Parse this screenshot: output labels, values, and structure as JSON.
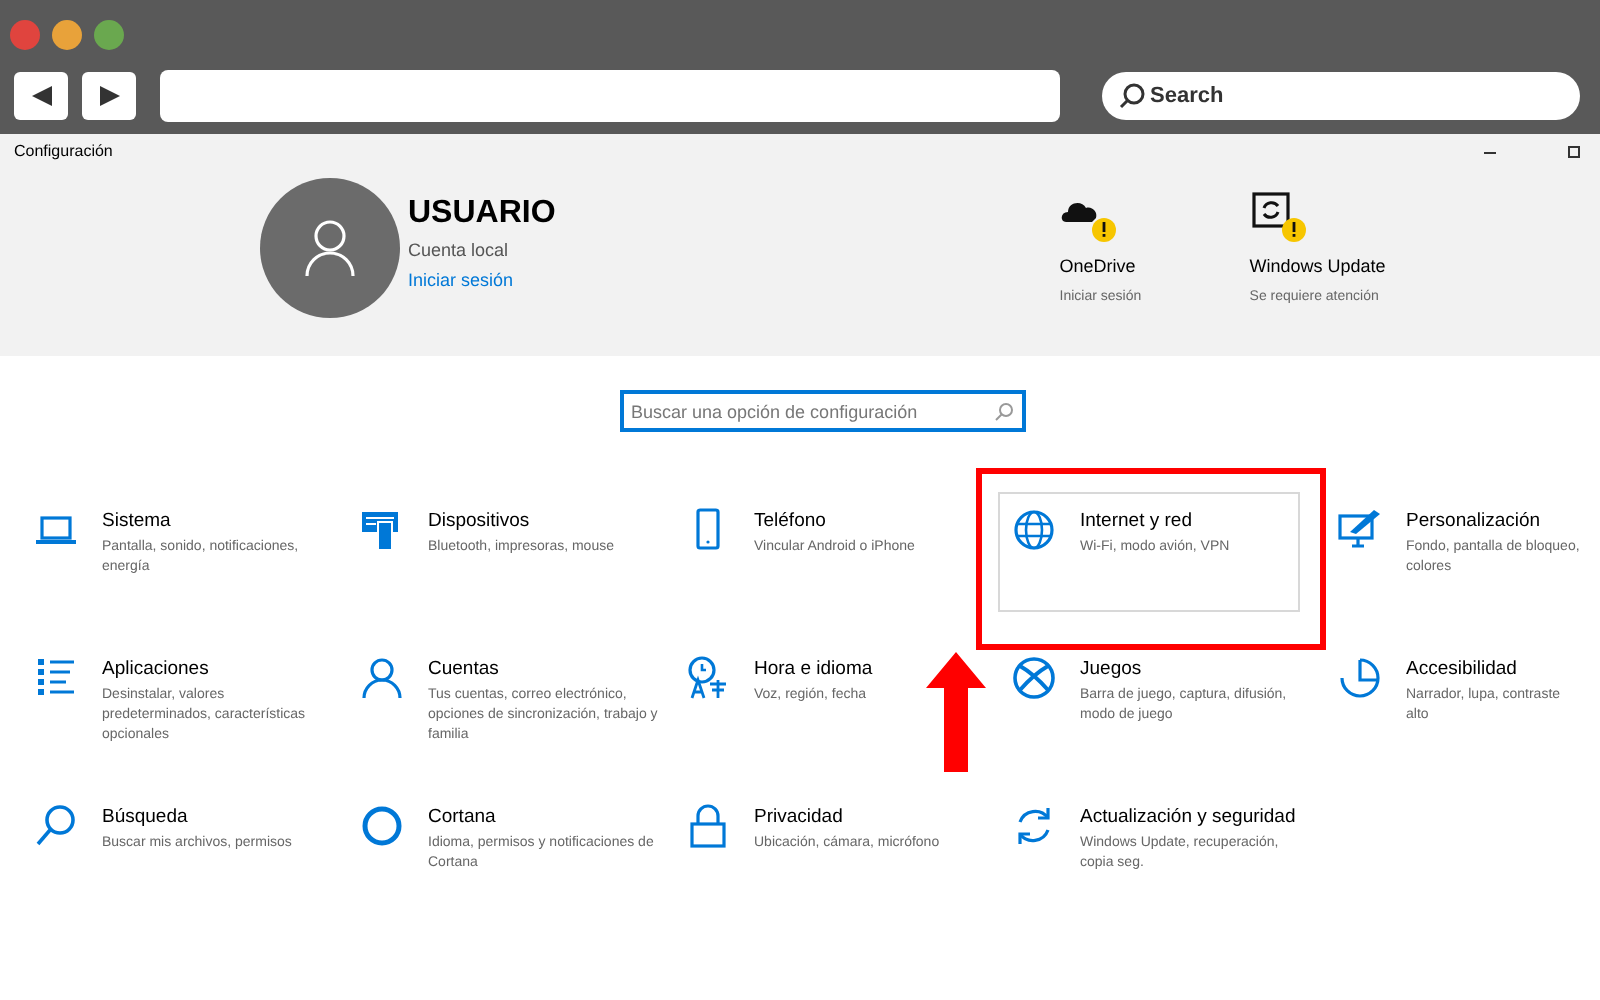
{
  "browser": {
    "search_placeholder": "Search"
  },
  "window": {
    "title": "Configuración"
  },
  "account": {
    "name": "USUARIO",
    "type": "Cuenta local",
    "link": "Iniciar sesión"
  },
  "status_items": [
    {
      "title": "OneDrive",
      "subtitle": "Iniciar sesión",
      "warning": true
    },
    {
      "title": "Windows Update",
      "subtitle": "Se requiere atención",
      "warning": true
    }
  ],
  "search": {
    "placeholder": "Buscar una opción de configuración"
  },
  "categories": [
    {
      "title": "Sistema",
      "description": "Pantalla, sonido, notificaciones, energía",
      "highlighted": false
    },
    {
      "title": "Dispositivos",
      "description": "Bluetooth, impresoras, mouse",
      "highlighted": false
    },
    {
      "title": "Teléfono",
      "description": "Vincular Android o iPhone",
      "highlighted": false
    },
    {
      "title": "Internet y red",
      "description": "Wi-Fi, modo avión, VPN",
      "highlighted": true
    },
    {
      "title": "Personalización",
      "description": "Fondo, pantalla de bloqueo, colores",
      "highlighted": false
    },
    {
      "title": "Aplicaciones",
      "description": "Desinstalar, valores predeterminados, características opcionales",
      "highlighted": false
    },
    {
      "title": "Cuentas",
      "description": "Tus cuentas, correo electrónico, opciones de sincronización, trabajo y familia",
      "highlighted": false
    },
    {
      "title": "Hora e idioma",
      "description": "Voz, región, fecha",
      "highlighted": false
    },
    {
      "title": "Juegos",
      "description": "Barra de juego, captura, difusión, modo de juego",
      "highlighted": false
    },
    {
      "title": "Accesibilidad",
      "description": "Narrador, lupa, contraste alto",
      "highlighted": false
    },
    {
      "title": "Búsqueda",
      "description": "Buscar mis archivos, permisos",
      "highlighted": false
    },
    {
      "title": "Cortana",
      "description": "Idioma, permisos y notificaciones de Cortana",
      "highlighted": false
    },
    {
      "title": "Privacidad",
      "description": "Ubicación, cámara, micrófono",
      "highlighted": false
    },
    {
      "title": "Actualización y seguridad",
      "description": "Windows Update, recuperación, copia seg.",
      "highlighted": false
    }
  ]
}
